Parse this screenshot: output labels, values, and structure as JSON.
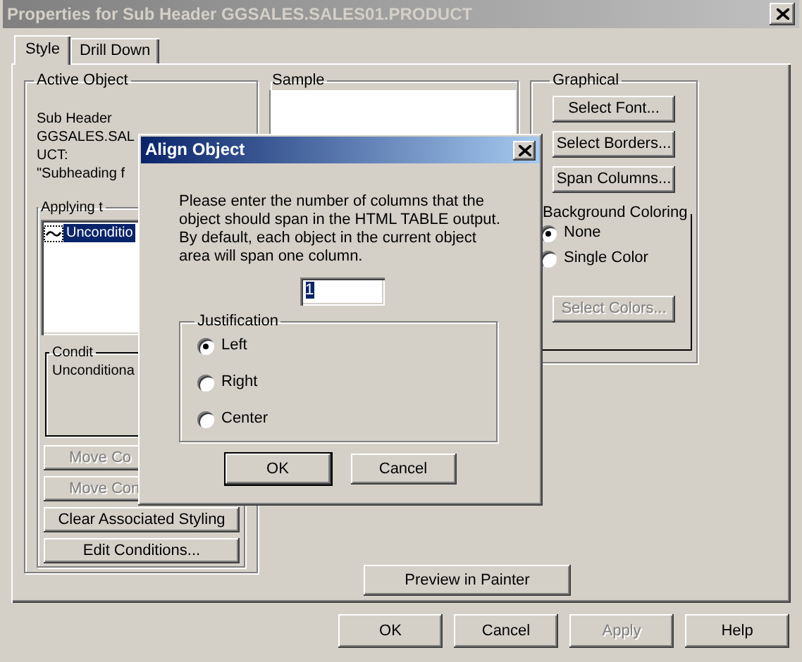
{
  "window": {
    "title": "Properties for Sub Header GGSALES.SALES01.PRODUCT"
  },
  "tabs": [
    {
      "label": "Style",
      "selected": true
    },
    {
      "label": "Drill Down",
      "selected": false
    }
  ],
  "active_object": {
    "title": "Active Object",
    "lines": [
      "Sub Header",
      "GGSALES.SAL",
      "UCT:",
      "\"Subheading f"
    ],
    "applying": {
      "title": "Applying t",
      "items": [
        {
          "label": "Unconditio",
          "selected": true
        }
      ]
    },
    "condition": {
      "title": "Condit",
      "text": "Unconditiona"
    },
    "buttons": [
      {
        "label": "Move Co",
        "disabled": true
      },
      {
        "label": "Move Con",
        "disabled": true
      },
      {
        "label": "Clear Associated Styling",
        "disabled": false
      },
      {
        "label": "Edit Conditions...",
        "disabled": false
      }
    ]
  },
  "sample": {
    "title": "Sample"
  },
  "graphical": {
    "title": "Graphical",
    "buttons": [
      {
        "label": "Select Font...",
        "disabled": false
      },
      {
        "label": "Select Borders...",
        "disabled": false
      },
      {
        "label": "Span Columns...",
        "disabled": false
      }
    ],
    "background": {
      "title": "Background Coloring",
      "options": [
        {
          "label": "None",
          "selected": true
        },
        {
          "label": "Single Color",
          "selected": false
        }
      ],
      "button": {
        "label": "Select Colors...",
        "disabled": true
      }
    }
  },
  "preview_button": {
    "label": "Preview in Painter",
    "disabled": false
  },
  "footer_buttons": [
    {
      "label": "OK",
      "disabled": false
    },
    {
      "label": "Cancel",
      "disabled": false
    },
    {
      "label": "Apply",
      "disabled": true
    },
    {
      "label": "Help",
      "disabled": false
    }
  ],
  "dialog": {
    "title": "Align Object",
    "message": "Please enter the number of columns that the object should span in the HTML TABLE output. By default, each object in the current object area will span one column.",
    "columns_value": "1",
    "justification": {
      "title": "Justification",
      "options": [
        {
          "label": "Left",
          "selected": true
        },
        {
          "label": "Right",
          "selected": false
        },
        {
          "label": "Center",
          "selected": false
        }
      ]
    },
    "buttons": [
      {
        "label": "OK",
        "disabled": false
      },
      {
        "label": "Cancel",
        "disabled": false
      }
    ]
  }
}
